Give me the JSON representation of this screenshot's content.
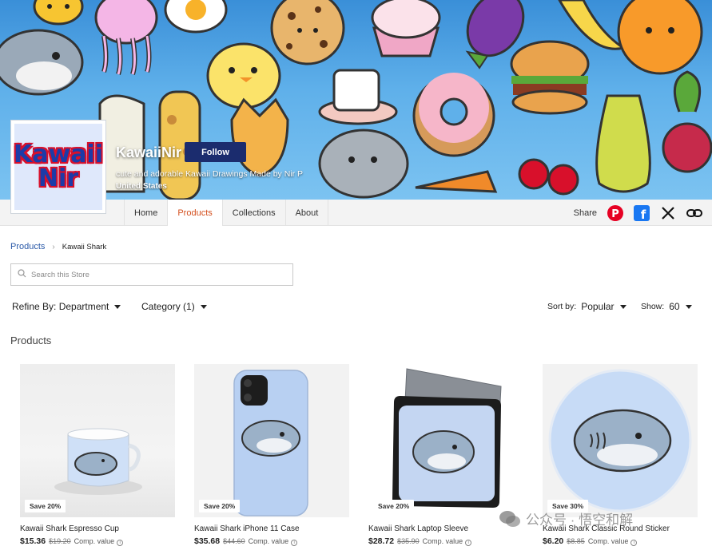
{
  "banner": {
    "logo_line1": "Kawaii",
    "logo_line2": "Nir",
    "store_name": "KawaiiNir",
    "follow_label": "Follow",
    "tagline": "cute and adorable Kawaii Drawings Made by Nir P",
    "country": "United States"
  },
  "nav": {
    "tabs": [
      {
        "label": "Home"
      },
      {
        "label": "Products",
        "active": true
      },
      {
        "label": "Collections"
      },
      {
        "label": "About"
      }
    ],
    "share_label": "Share",
    "share_icons": [
      "pinterest-icon",
      "facebook-icon",
      "x-icon",
      "link-icon"
    ]
  },
  "breadcrumb": {
    "parent": "Products",
    "current": "Kawaii Shark"
  },
  "search": {
    "placeholder": "Search this Store"
  },
  "filters": {
    "refine": "Refine By: Department",
    "category": "Category (1)",
    "sort_label": "Sort by:",
    "sort_value": "Popular",
    "show_label": "Show:",
    "show_value": "60"
  },
  "section_title": "Products",
  "products": [
    {
      "badge": "Save 20%",
      "title": "Kawaii Shark Espresso Cup",
      "price": "$15.36",
      "was": "$19.20",
      "comp": "Comp. value"
    },
    {
      "badge": "Save 20%",
      "title": "Kawaii Shark iPhone 11 Case",
      "price": "$35.68",
      "was": "$44.60",
      "comp": "Comp. value"
    },
    {
      "badge": "Save 20%",
      "title": "Kawaii Shark Laptop Sleeve",
      "price": "$28.72",
      "was": "$35.90",
      "comp": "Comp. value"
    },
    {
      "badge": "Save 30%",
      "title": "Kawaii Shark Classic Round Sticker",
      "price": "$6.20",
      "was": "$8.85",
      "comp": "Comp. value"
    }
  ],
  "watermark": "公众号 · 悟空和解",
  "colors": {
    "accent": "#d4501f",
    "follow_bg": "#1b2c6e",
    "link": "#2a59a8",
    "pinterest": "#e60023",
    "facebook": "#1877f2"
  }
}
